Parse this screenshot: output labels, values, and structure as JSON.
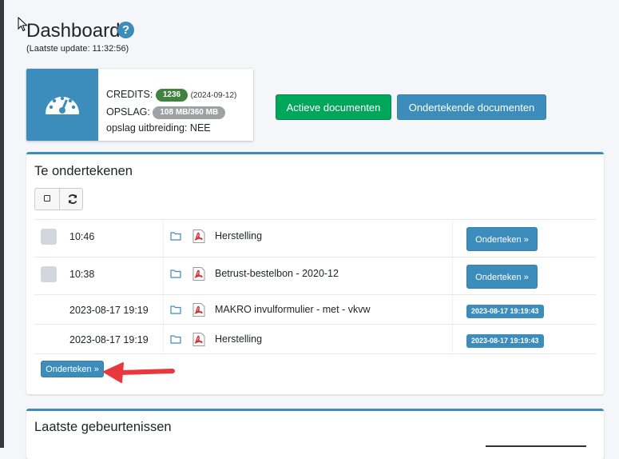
{
  "header": {
    "title": "Dashboard",
    "help_icon": "?",
    "last_update": "(Laatste update: 11:32:56)"
  },
  "info_box": {
    "icon": "dashboard-gauge-icon",
    "credits_label": "CREDITS:",
    "credits_value": "1236",
    "credits_date": "(2024-09-12)",
    "storage_label": "OPSLAG:",
    "storage_value": "108 MB/360 MB",
    "storage_extension": "opslag uitbreiding: NEE"
  },
  "buttons": {
    "active_documents": "Actieve documenten",
    "signed_documents": "Ondertekende documenten"
  },
  "sign_panel": {
    "title": "Te ondertekenen",
    "rows": [
      {
        "time": "10:46",
        "filename": "Herstelling",
        "action": "Onderteken »",
        "type": "pending"
      },
      {
        "time": "10:38",
        "filename": "Betrust-bestelbon - 2020-12",
        "action": "Onderteken »",
        "type": "pending"
      },
      {
        "time": "2023-08-17 19:19",
        "filename": "MAKRO invulformulier - met - vkvw",
        "action": "2023-08-17 19:19:43",
        "type": "signed"
      },
      {
        "time": "2023-08-17 19:19",
        "filename": "Herstelling",
        "action": "2023-08-17 19:19:43",
        "type": "signed"
      }
    ],
    "bulk_sign": "Onderteken »"
  },
  "events_panel": {
    "title": "Laatste gebeurtenissen"
  },
  "colors": {
    "primary": "#3c8dbc",
    "success": "#00a65a",
    "annotation_arrow": "#e8383d"
  }
}
